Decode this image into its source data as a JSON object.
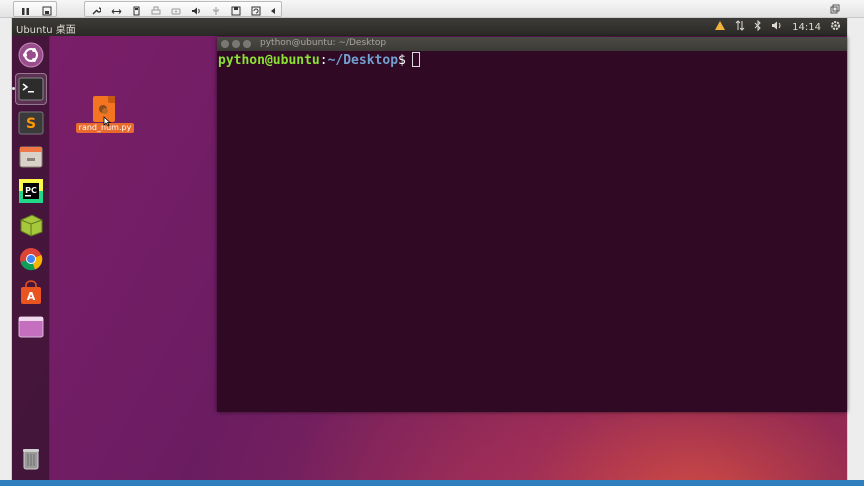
{
  "vm_toolbar": {
    "buttons": [
      "pause-icon",
      "snapshot-icon",
      "wrench-icon",
      "resize-icon",
      "usb-icon",
      "printer-icon",
      "disk-icon",
      "sound-icon",
      "plug-icon",
      "save-icon",
      "refresh-icon",
      "collapse-icon"
    ]
  },
  "top_panel": {
    "title": "Ubuntu 桌面",
    "clock": "14:14",
    "indicators": [
      "notification-icon",
      "network-icon",
      "bluetooth-icon",
      "volume-icon",
      "gear-icon"
    ]
  },
  "launcher": {
    "items": [
      "dash-home",
      "terminal",
      "sublime-text",
      "files",
      "pycharm",
      "books",
      "chrome",
      "software-center",
      "workspaces",
      "trash"
    ]
  },
  "desktop": {
    "file_name": "rand_num.py"
  },
  "terminal": {
    "title": "python@ubuntu: ~/Desktop",
    "prompt_user": "python@ubuntu",
    "prompt_colon": ":",
    "prompt_path": "~/Desktop",
    "prompt_dollar": "$"
  },
  "colors": {
    "terminal_bg": "#300a24",
    "prompt_user": "#8ae234",
    "prompt_path": "#729fcf",
    "file_highlight": "#e86a2c"
  }
}
